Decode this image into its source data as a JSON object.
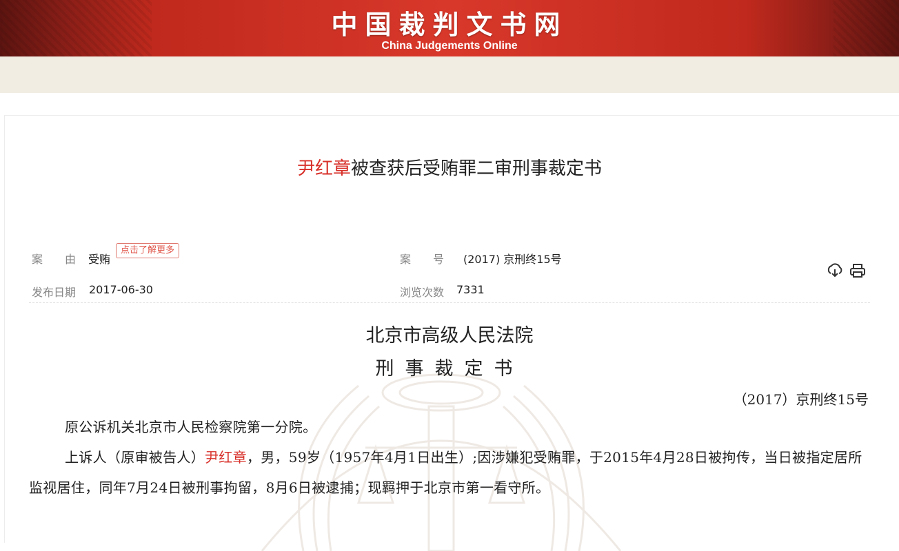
{
  "header": {
    "site_title": "中国裁判文书网",
    "site_subtitle": "China Judgements Online"
  },
  "document": {
    "title_highlight": "尹红章",
    "title_rest": "被查获后受贿罪二审刑事裁定书",
    "meta": {
      "cause_label": "案　　由",
      "cause_value": "受贿",
      "learn_more": "点击了解更多",
      "case_no_label": "案　　号",
      "case_no_value": "(2017) 京刑终15号",
      "publish_date_label": "发布日期",
      "publish_date_value": "2017-06-30",
      "view_count_label": "浏览次数",
      "view_count_value": "7331"
    },
    "court": "北京市高级人民法院",
    "doc_type": "刑事裁定书",
    "case_no": "（2017）京刑终15号",
    "para1": "原公诉机关北京市人民检察院第一分院。",
    "para2_pre": "上诉人（原审被告人）",
    "para2_name": "尹红章",
    "para2_post": "，男，59岁（1957年4月1日出生）;因涉嫌犯受贿罪，于2015年4月28日被拘传，当日被指定居所监视居住，同年7月24日被刑事拘留，8月6日被逮捕；现羁押于北京市第一看守所。"
  },
  "icons": {
    "download": "download-icon",
    "print": "print-icon"
  },
  "colors": {
    "banner_red": "#d8382a",
    "highlight_red": "#d8302a",
    "nav_strip": "#f2ede3"
  }
}
